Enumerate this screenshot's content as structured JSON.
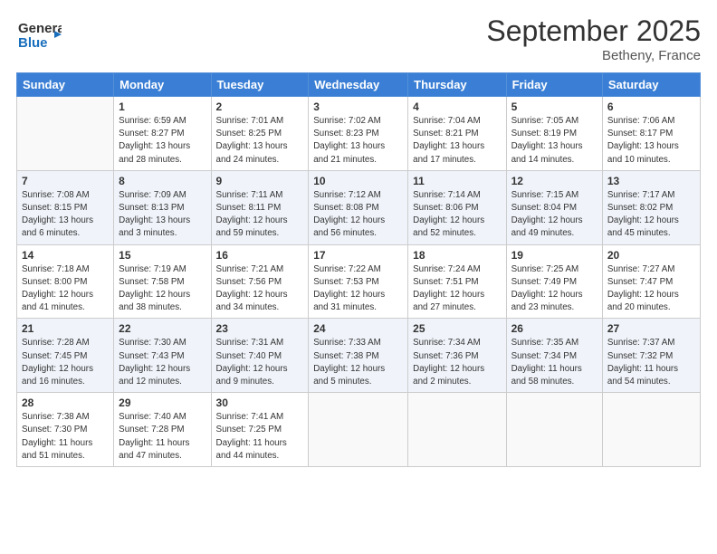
{
  "logo": {
    "line1": "General",
    "line2": "Blue",
    "icon": "▶"
  },
  "title": "September 2025",
  "location": "Betheny, France",
  "days_header": [
    "Sunday",
    "Monday",
    "Tuesday",
    "Wednesday",
    "Thursday",
    "Friday",
    "Saturday"
  ],
  "weeks": [
    [
      {
        "day": "",
        "info": ""
      },
      {
        "day": "1",
        "info": "Sunrise: 6:59 AM\nSunset: 8:27 PM\nDaylight: 13 hours\nand 28 minutes."
      },
      {
        "day": "2",
        "info": "Sunrise: 7:01 AM\nSunset: 8:25 PM\nDaylight: 13 hours\nand 24 minutes."
      },
      {
        "day": "3",
        "info": "Sunrise: 7:02 AM\nSunset: 8:23 PM\nDaylight: 13 hours\nand 21 minutes."
      },
      {
        "day": "4",
        "info": "Sunrise: 7:04 AM\nSunset: 8:21 PM\nDaylight: 13 hours\nand 17 minutes."
      },
      {
        "day": "5",
        "info": "Sunrise: 7:05 AM\nSunset: 8:19 PM\nDaylight: 13 hours\nand 14 minutes."
      },
      {
        "day": "6",
        "info": "Sunrise: 7:06 AM\nSunset: 8:17 PM\nDaylight: 13 hours\nand 10 minutes."
      }
    ],
    [
      {
        "day": "7",
        "info": "Sunrise: 7:08 AM\nSunset: 8:15 PM\nDaylight: 13 hours\nand 6 minutes."
      },
      {
        "day": "8",
        "info": "Sunrise: 7:09 AM\nSunset: 8:13 PM\nDaylight: 13 hours\nand 3 minutes."
      },
      {
        "day": "9",
        "info": "Sunrise: 7:11 AM\nSunset: 8:11 PM\nDaylight: 12 hours\nand 59 minutes."
      },
      {
        "day": "10",
        "info": "Sunrise: 7:12 AM\nSunset: 8:08 PM\nDaylight: 12 hours\nand 56 minutes."
      },
      {
        "day": "11",
        "info": "Sunrise: 7:14 AM\nSunset: 8:06 PM\nDaylight: 12 hours\nand 52 minutes."
      },
      {
        "day": "12",
        "info": "Sunrise: 7:15 AM\nSunset: 8:04 PM\nDaylight: 12 hours\nand 49 minutes."
      },
      {
        "day": "13",
        "info": "Sunrise: 7:17 AM\nSunset: 8:02 PM\nDaylight: 12 hours\nand 45 minutes."
      }
    ],
    [
      {
        "day": "14",
        "info": "Sunrise: 7:18 AM\nSunset: 8:00 PM\nDaylight: 12 hours\nand 41 minutes."
      },
      {
        "day": "15",
        "info": "Sunrise: 7:19 AM\nSunset: 7:58 PM\nDaylight: 12 hours\nand 38 minutes."
      },
      {
        "day": "16",
        "info": "Sunrise: 7:21 AM\nSunset: 7:56 PM\nDaylight: 12 hours\nand 34 minutes."
      },
      {
        "day": "17",
        "info": "Sunrise: 7:22 AM\nSunset: 7:53 PM\nDaylight: 12 hours\nand 31 minutes."
      },
      {
        "day": "18",
        "info": "Sunrise: 7:24 AM\nSunset: 7:51 PM\nDaylight: 12 hours\nand 27 minutes."
      },
      {
        "day": "19",
        "info": "Sunrise: 7:25 AM\nSunset: 7:49 PM\nDaylight: 12 hours\nand 23 minutes."
      },
      {
        "day": "20",
        "info": "Sunrise: 7:27 AM\nSunset: 7:47 PM\nDaylight: 12 hours\nand 20 minutes."
      }
    ],
    [
      {
        "day": "21",
        "info": "Sunrise: 7:28 AM\nSunset: 7:45 PM\nDaylight: 12 hours\nand 16 minutes."
      },
      {
        "day": "22",
        "info": "Sunrise: 7:30 AM\nSunset: 7:43 PM\nDaylight: 12 hours\nand 12 minutes."
      },
      {
        "day": "23",
        "info": "Sunrise: 7:31 AM\nSunset: 7:40 PM\nDaylight: 12 hours\nand 9 minutes."
      },
      {
        "day": "24",
        "info": "Sunrise: 7:33 AM\nSunset: 7:38 PM\nDaylight: 12 hours\nand 5 minutes."
      },
      {
        "day": "25",
        "info": "Sunrise: 7:34 AM\nSunset: 7:36 PM\nDaylight: 12 hours\nand 2 minutes."
      },
      {
        "day": "26",
        "info": "Sunrise: 7:35 AM\nSunset: 7:34 PM\nDaylight: 11 hours\nand 58 minutes."
      },
      {
        "day": "27",
        "info": "Sunrise: 7:37 AM\nSunset: 7:32 PM\nDaylight: 11 hours\nand 54 minutes."
      }
    ],
    [
      {
        "day": "28",
        "info": "Sunrise: 7:38 AM\nSunset: 7:30 PM\nDaylight: 11 hours\nand 51 minutes."
      },
      {
        "day": "29",
        "info": "Sunrise: 7:40 AM\nSunset: 7:28 PM\nDaylight: 11 hours\nand 47 minutes."
      },
      {
        "day": "30",
        "info": "Sunrise: 7:41 AM\nSunset: 7:25 PM\nDaylight: 11 hours\nand 44 minutes."
      },
      {
        "day": "",
        "info": ""
      },
      {
        "day": "",
        "info": ""
      },
      {
        "day": "",
        "info": ""
      },
      {
        "day": "",
        "info": ""
      }
    ]
  ]
}
